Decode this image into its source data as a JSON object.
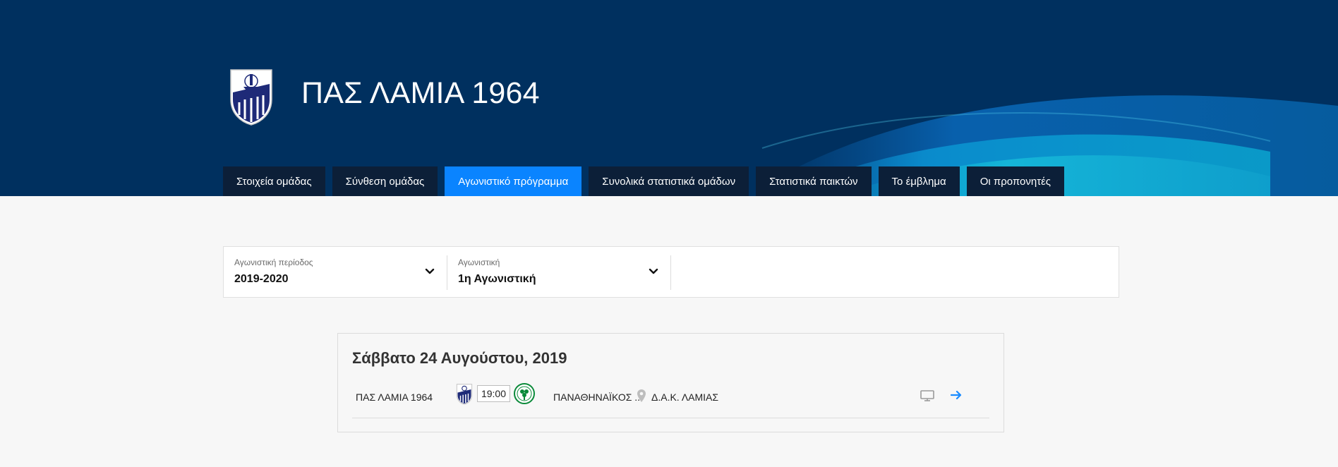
{
  "team": {
    "name": "ΠΑΣ ΛΑΜΙΑ 1964",
    "crest_text": "Π.Α.Σ. ΛΑΜΙΑ"
  },
  "tabs": [
    {
      "label": "Στοιχεία ομάδας",
      "active": false
    },
    {
      "label": "Σύνθεση ομάδας",
      "active": false
    },
    {
      "label": "Αγωνιστικό πρόγραμμα",
      "active": true
    },
    {
      "label": "Συνολικά στατιστικά ομάδων",
      "active": false
    },
    {
      "label": "Στατιστικά παικτών",
      "active": false
    },
    {
      "label": "Το έμβλημα",
      "active": false
    },
    {
      "label": "Οι προπονητές",
      "active": false
    }
  ],
  "filters": {
    "season": {
      "label": "Αγωνιστική περίοδος",
      "value": "2019-2020",
      "icon": "chevron-down-icon"
    },
    "matchday": {
      "label": "Αγωνιστική",
      "value": "1η Αγωνιστική",
      "icon": "chevron-down-icon"
    }
  },
  "schedule": {
    "date": "Σάββατο 24 Αυγούστου, 2019",
    "matches": [
      {
        "home": "ΠΑΣ ΛΑΜΙΑ 1964",
        "time": "19:00",
        "away": "ΠΑΝΑΘΗΝΑΪΚΟΣ ...",
        "venue": "Δ.Α.Κ. ΛΑΜΙΑΣ"
      }
    ]
  },
  "colors": {
    "hero_bg": "#00305f",
    "tab_bg": "#0c1f38",
    "tab_active": "#0a84ff",
    "link_blue": "#1a8cff"
  }
}
